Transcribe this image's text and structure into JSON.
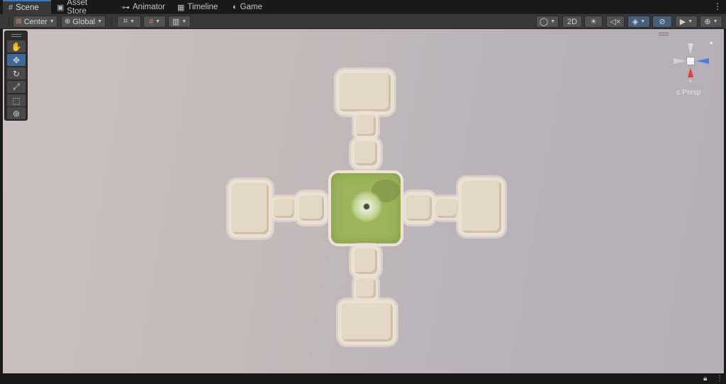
{
  "tabs": [
    {
      "label": "Scene",
      "icon": "grid-icon",
      "active": true
    },
    {
      "label": "Asset Store",
      "icon": "bag-icon"
    },
    {
      "label": "Animator",
      "icon": "animator-icon"
    },
    {
      "label": "Timeline",
      "icon": "film-icon"
    },
    {
      "label": "Game",
      "icon": "gamepad-icon"
    }
  ],
  "toolbar": {
    "pivot_mode": "Center",
    "pivot_rotation": "Global",
    "view_2d": "2D"
  },
  "tools": [
    "hand-tool",
    "move-tool",
    "rotate-tool",
    "scale-tool",
    "rect-tool",
    "transform-tool"
  ],
  "gizmo": {
    "x_label": "x",
    "projection": "Persp"
  },
  "colors": {
    "accent": "#3a79bb",
    "selected_tool": "#3f6896",
    "grass": "#9cb45c",
    "tile": "#e3d8c5",
    "gizmo_x": "#e04040",
    "gizmo_z": "#4d7de8"
  }
}
